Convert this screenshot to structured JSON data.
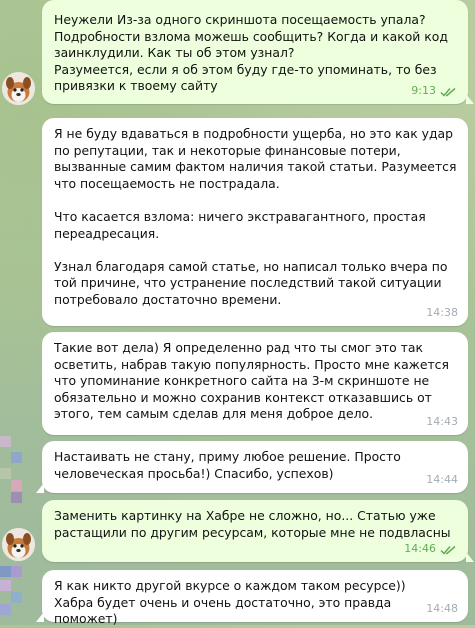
{
  "colors": {
    "outgoing_bg": "#eeffde",
    "incoming_bg": "#ffffff",
    "time_out": "#62ac55",
    "time_in": "#a3acb5"
  },
  "messages": [
    {
      "direction": "outgoing",
      "text": "Неужели Из-за одного скриншота посещаемость упала?\nПодробности взлома можешь сообщить? Когда и какой код заинклудили. Как ты об этом узнал?\nРазумеется, если я об этом буду где-то упоминать, то без привязки к твоему сайту",
      "time": "9:13",
      "status": "read-double-check-icon"
    },
    {
      "direction": "incoming",
      "text": "Я не буду вдаваться в подробности ущерба, но это как удар по репутации, так и некоторые финансовые потери, вызванные самим фактом наличия такой статьи. Разумеется что посещаемость не пострадала.\n\nЧто касается взлома: ничего экстравагантного, простая переадресация.\n\nУзнал благодаря самой статье, но написал только вчера по той причине, что устранение последствий такой ситуации потребовало достаточно времени.",
      "time": "14:38"
    },
    {
      "direction": "incoming",
      "text": "Такие вот дела) Я определенно рад что ты смог это так осветить, набрав такую популярность. Просто мне кажется что упоминание конкретного сайта на 3-м скриншоте не обязательно и можно сохранив контекст отказавшись от этого, тем самым сделав для меня доброе дело.",
      "time": "14:43"
    },
    {
      "direction": "incoming",
      "text": "Настаивать не стану, приму любое решение. Просто человеческая просьба!) Спасибо, успехов)",
      "time": "14:44"
    },
    {
      "direction": "outgoing",
      "text": "Заменить картинку на Хабре не сложно, но... Статью уже растащили по другим ресурсам, которые мне не подвласны",
      "time": "14:46",
      "status": "read-double-check-icon"
    },
    {
      "direction": "incoming",
      "text": "Я как никто другой вкурсе о каждом таком ресурсе)) Хабра будет очень и очень достаточно, это правда поможет)",
      "time": "14:48"
    }
  ]
}
